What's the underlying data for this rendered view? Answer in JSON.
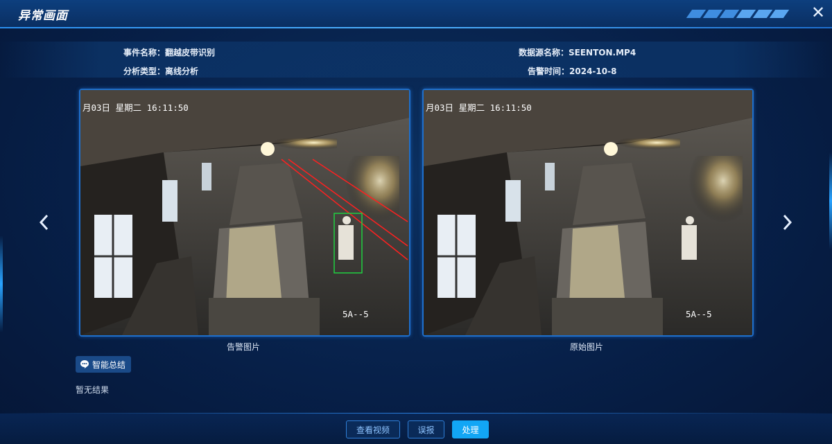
{
  "dialog": {
    "title": "异常画面",
    "close_icon": "close-icon"
  },
  "info": {
    "event_name_label": "事件名称：",
    "event_name_value": "翻越皮带识别",
    "analysis_type_label": "分析类型：",
    "analysis_type_value": "离线分析",
    "datasource_label": "数据源名称：",
    "datasource_value": "SEENTON.MP4",
    "alarm_time_label": "告警时间：",
    "alarm_time_value": "2024-10-8"
  },
  "images": {
    "alarm": {
      "caption": "告警图片",
      "osd_time": "月03日 星期二 16:11:50",
      "osd_camera": "5A--5"
    },
    "original": {
      "caption": "原始图片",
      "osd_time": "月03日 星期二 16:11:50",
      "osd_camera": "5A--5"
    }
  },
  "navigation": {
    "prev_icon": "chevron-left-icon",
    "next_icon": "chevron-right-icon"
  },
  "summary": {
    "tag_label": "智能总结",
    "tag_icon": "chat-bubble-icon",
    "result_text": "暂无结果"
  },
  "footer": {
    "view_video_label": "查看视频",
    "false_alarm_label": "误报",
    "handle_label": "处理"
  },
  "colors": {
    "accent": "#12a6f5",
    "border": "#2f7fd8",
    "alarm_zone": "#ff2020",
    "detection_box": "#20d040"
  }
}
